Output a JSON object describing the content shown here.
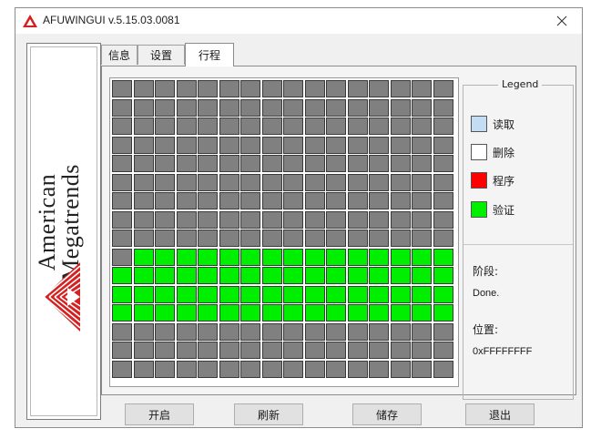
{
  "window": {
    "title": "AFUWINGUI v.5.15.03.0081"
  },
  "logo": {
    "line1": "American",
    "line2": "Megatrends"
  },
  "tabs": [
    {
      "label": "信息",
      "active": false
    },
    {
      "label": "设置",
      "active": false
    },
    {
      "label": "行程",
      "active": true
    }
  ],
  "progress_grid": {
    "columns": 16,
    "rows": 16,
    "blocks_total": 256,
    "rows_status": [
      "gray",
      "gray",
      "gray",
      "gray",
      "gray",
      "gray",
      "gray",
      "gray",
      "gray",
      "green_from_col_2",
      "green",
      "green",
      "green",
      "gray",
      "gray",
      "gray"
    ]
  },
  "legend": {
    "title": "Legend",
    "items": [
      {
        "label": "读取",
        "color": "#c5dcf5"
      },
      {
        "label": "删除",
        "color": "#ffffff"
      },
      {
        "label": "程序",
        "color": "#ff0000"
      },
      {
        "label": "验证",
        "color": "#00ee00"
      }
    ]
  },
  "status": {
    "phase_label": "阶段:",
    "phase_value": "Done.",
    "position_label": "位置:",
    "position_value": "0xFFFFFFFF"
  },
  "buttons": {
    "start": "开启",
    "flash": "刷新",
    "save": "储存",
    "exit": "退出"
  },
  "colors": {
    "gray_block": "#808080",
    "green_block": "#00ee00",
    "brand_red": "#d42020"
  }
}
